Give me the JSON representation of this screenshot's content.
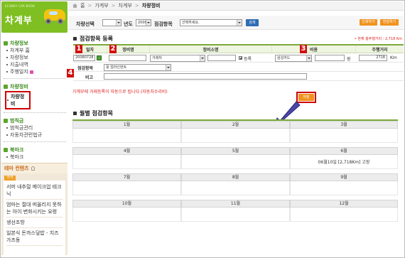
{
  "sidebar": {
    "logo_sub": "ECONSY CAR BOOK",
    "logo_title": "차계부",
    "groups": [
      {
        "title": "차량정보",
        "items": [
          "차계부 홈",
          "차량정보",
          "지출내역",
          "주행일지"
        ]
      },
      {
        "title": "차량정비",
        "items": [
          "차량정비"
        ]
      },
      {
        "title": "범칙금",
        "items": [
          "범칙금관리",
          "자동차관련법규"
        ]
      },
      {
        "title": "북마크",
        "items": [
          "북마크"
        ]
      }
    ]
  },
  "theme": {
    "title": "테마 컨텐츠",
    "tab": "카카",
    "items": [
      "서머 내추럴 메이크업 테크닉",
      "엄마는 절대 떠올리지 못하는 아이 변화시키는 요령",
      "생선조방",
      "일본식 돈까스덮밥 - 치즈 가츠동"
    ]
  },
  "breadcrumb": {
    "home": "홈",
    "items": [
      "가계부",
      "차계부"
    ],
    "current": "차량정비"
  },
  "toolbar": {
    "car_label": "차량선택",
    "year_label": "년도",
    "year_value": "2008",
    "category_label": "점검항목",
    "category_placeholder": "선택하세요.",
    "search_button": "검색",
    "print_button": "인쇄하기",
    "share_button": "전달하기"
  },
  "register": {
    "title": "점검항목 등록",
    "notice": "• 현재 총주행거리 : 2,718 Km",
    "headers": [
      "일자",
      "정비명",
      "정비소명",
      "비용",
      "주행거리"
    ],
    "date_value": "20080728",
    "shop_value": "거래처",
    "register_label": "등록",
    "card_value": "삼성카드",
    "won_unit": "원",
    "distance_value": "2718",
    "distance_unit": "Km",
    "item_label": "점검항목",
    "item_value": "휠 얼라인먼트",
    "note_label": "비고",
    "markers": [
      "1",
      "2",
      "3",
      "4"
    ],
    "warning": "가계부에 거래등록이 자동으로 됩니다.(자동차수리비)",
    "save_button": "저장"
  },
  "monthly": {
    "title": "월별 점검항목",
    "months": [
      "1월",
      "2월",
      "3월",
      "4월",
      "5월",
      "6월",
      "7월",
      "8월",
      "9월",
      "10월",
      "11월",
      "12월"
    ],
    "entries": {
      "6월": "06월10일 [2,718Km] 고장"
    }
  },
  "colors": {
    "green": "#7fbf22",
    "orange": "#f0921f",
    "red": "#d10f0f",
    "blue": "#2e6db4"
  }
}
